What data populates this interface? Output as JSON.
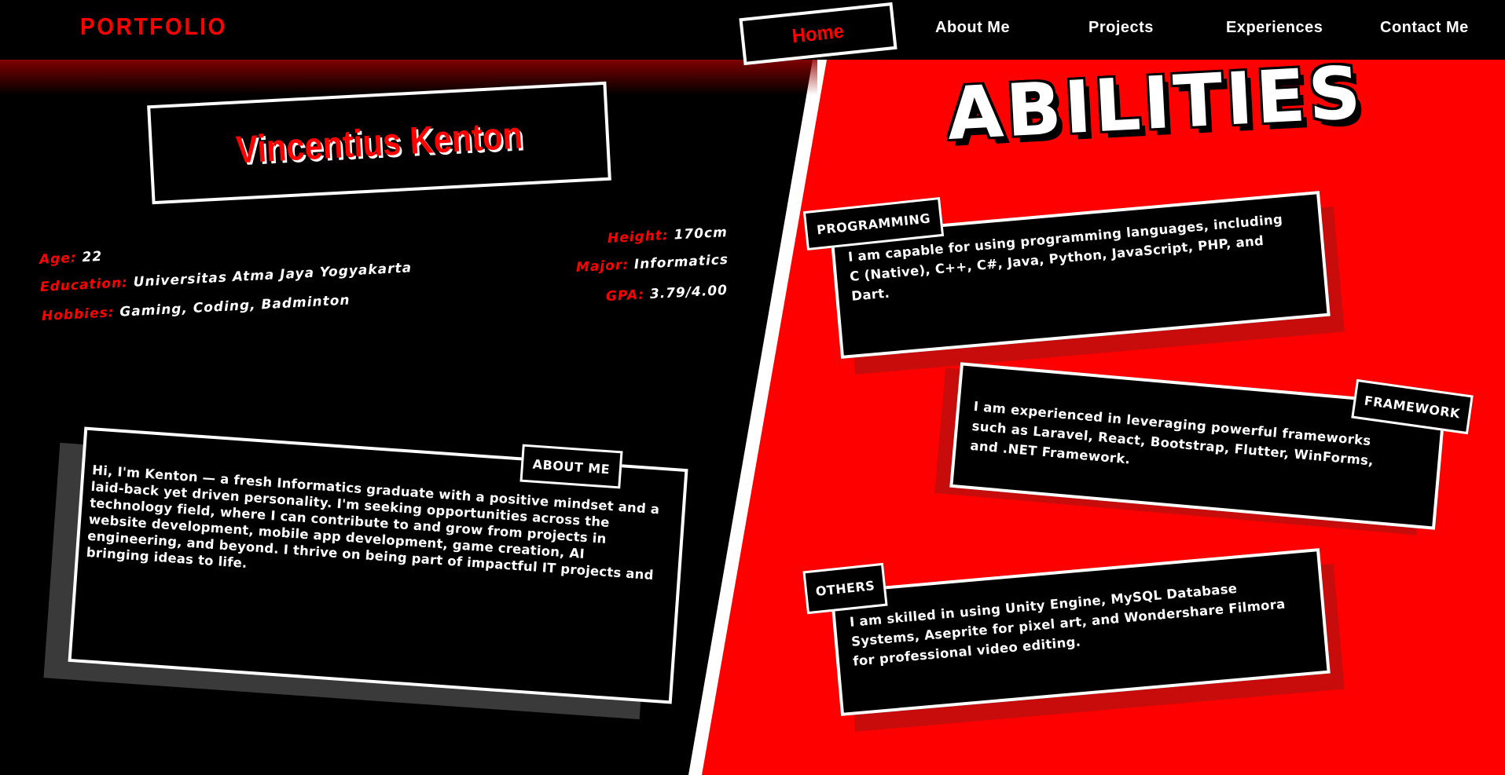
{
  "nav": {
    "logo": "PORTFOLIO",
    "home": "Home",
    "about": "About Me",
    "projects": "Projects",
    "experiences": "Experiences",
    "contact": "Contact Me"
  },
  "profile": {
    "name": "Vincentius Kenton",
    "age_label": "Age:",
    "age": "22",
    "education_label": "Education:",
    "education": "Universitas Atma Jaya Yogyakarta",
    "hobbies_label": "Hobbies:",
    "hobbies": "Gaming, Coding, Badminton",
    "height_label": "Height:",
    "height": "170cm",
    "major_label": "Major:",
    "major": "Informatics",
    "gpa_label": "GPA:",
    "gpa": "3.79/4.00"
  },
  "about": {
    "tag": "ABOUT ME",
    "text": "Hi, I'm Kenton — a fresh Informatics graduate with a positive mindset and a laid-back yet driven personality. I'm seeking opportunities across the technology field, where I can contribute to and grow from projects in website development, mobile app development, game creation, AI engineering, and beyond. I thrive on being part of impactful IT projects and bringing ideas to life."
  },
  "abilities": {
    "title": "ABILITIES",
    "programming": {
      "tag": "PROGRAMMING",
      "text": "I am capable for using programming languages, including C (Native), C++, C#, Java, Python, JavaScript, PHP, and Dart."
    },
    "framework": {
      "tag": "FRAMEWORK",
      "text": "I am experienced in leveraging powerful frameworks such as Laravel, React, Bootstrap, Flutter, WinForms, and .NET Framework."
    },
    "others": {
      "tag": "OTHERS",
      "text": "I am skilled in using Unity Engine, MySQL Database Systems, Aseprite for pixel art, and Wondershare Filmora for professional video editing."
    }
  },
  "colors": {
    "accent": "#ff0000",
    "background": "#000000",
    "card_shadow": "#c80c0c"
  }
}
